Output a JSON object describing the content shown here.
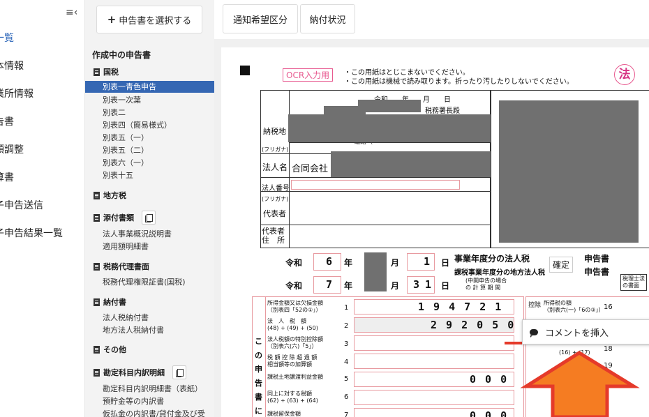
{
  "nav": {
    "items": [
      "一覧",
      "本情報",
      "業所情報",
      "告書",
      "類調整",
      "算書",
      "子申告送信",
      "子申告結果一覧"
    ]
  },
  "panel": {
    "select_button": "申告書を選択する",
    "title": "作成中の申告書",
    "groups": {
      "kokuzei": "国税",
      "chihouzei": "地方税",
      "tenpu": "添付書類",
      "zeirishi": "税務代理書面",
      "nofusho": "納付書",
      "sonota": "その他",
      "kanjo": "勘定科目内訳明細"
    },
    "kokuzei_items": [
      "別表一青色申告",
      "別表一次葉",
      "別表二",
      "別表四（簡易様式）",
      "別表五（一）",
      "別表五（二）",
      "別表六（一）",
      "別表十五"
    ],
    "tenpu_items": [
      "法人事業概況説明書",
      "適用額明細書"
    ],
    "zeirishi_items": [
      "税務代理権限証書(国税)"
    ],
    "nofusho_items": [
      "法人税納付書",
      "地方法人税納付書"
    ],
    "kanjo_items": [
      "勘定科目内訳明細書（表紙）",
      "預貯金等の内訳書",
      "仮払金の内訳書/貸付金及び受"
    ]
  },
  "tabs": [
    "通知希望区分",
    "納付状況"
  ],
  "form": {
    "ocr_label": "OCR入力用",
    "notice1": "・この用紙はとじこまないでください。",
    "notice2": "・この用紙は機械で読み取ります。折ったり汚したりしないでください。",
    "hou": "法",
    "reiwa_top": "令和　　年　　月　　日",
    "zeimusho": "税務署長殿",
    "nozeichi": "納税地",
    "denwa": "電話（",
    "furigana": "(フリガナ)",
    "hojinmei": "法人名",
    "company_name": "合同会社",
    "hojin_bango": "法人番号",
    "daihyosha": "代表者",
    "daihyosha_jusho": "代表者\n住　所",
    "reiwa": "令和",
    "from_year": "6",
    "to_year": "7",
    "from_day": "1",
    "to_month": "3",
    "to_day": "1",
    "nen": "年",
    "tsuki": "月",
    "hi": "日",
    "jigyo_line1": "事業年度分の法人税",
    "jigyo_line2": "課税事業年度分の地方法人税",
    "kakutei": "確定",
    "shinkokusho": "申告書",
    "chukan": "(中間申告の場合\nの 計 算 期 間",
    "row1_label": "所得金額又は欠損金額\n（別表四「52の①」）",
    "row1_value": "1 9 4 7 2 1",
    "row2_label": "法　人　税　額\n(48) + (49) + (50)",
    "row2_value": "2 9 2 0 5 0",
    "row3_label": "法人税額の特別控除額\n（別表六(六)「5」）",
    "row4_label": "税 額 控 除 超 過 額\n相当額等の加算額",
    "row5_label": "課税土地譲渡利益金額",
    "row6_label": "同上に対する税額\n(62) + (63) + (64)",
    "row7_label": "課税留保金額",
    "zeros": "0 0 0",
    "vertical_label": "この申告書に",
    "right_label1": "所得税の額\n（別表六(一)「6の③」）",
    "right_num1": "16",
    "right_calc": "(16) + (17)",
    "right_num2": "18",
    "right_num3": "19",
    "koujo": "控除",
    "zeirishi_shomen": "税理士法\nの書面",
    "comment_insert": "コメントを挿入"
  }
}
